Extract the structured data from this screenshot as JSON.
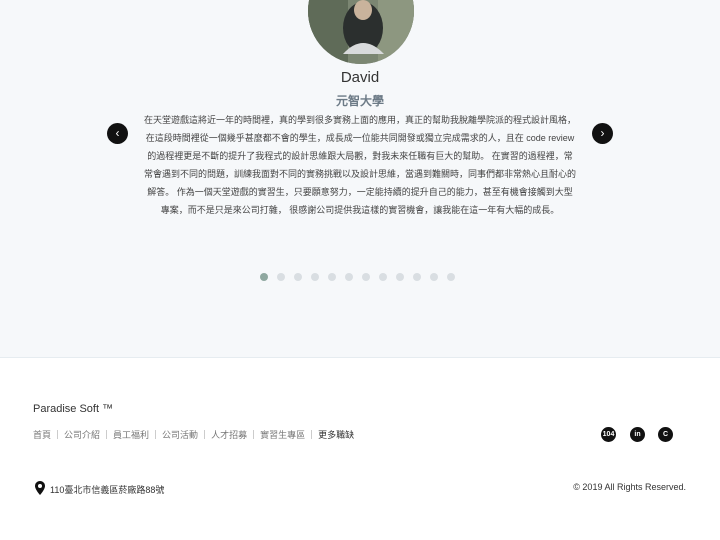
{
  "testimonial": {
    "name": "David",
    "school": "元智大學",
    "quote": "在天堂遊戲這將近一年的時間裡，真的學到很多實務上面的應用，真正的幫助我脫離學院派的程式設計風格，在這段時間裡從一個幾乎甚麼都不會的學生，成長成一位能共同開發或獨立完成需求的人，且在 code review 的過程裡更是不斷的提升了我程式的設計思維跟大局觀，對我未來任職有巨大的幫助。 在實習的過程裡，常常會遇到不同的問題，訓練我面對不同的實務挑戰以及設計思維，當遇到難關時，同事們都非常熱心且耐心的解答。 作為一個天堂遊戲的實習生，只要願意努力，一定能持續的提升自己的能力，甚至有機會接觸到大型專案，而不是只是來公司打雜， 很感謝公司提供我這樣的實習機會，讓我能在這一年有大幅的成長。",
    "prev_label": "‹",
    "next_label": "›",
    "slide_count": 12,
    "active_slide": 1
  },
  "footer": {
    "brand": "Paradise Soft ™",
    "nav": [
      "首頁",
      "公司介紹",
      "員工福利",
      "公司活動",
      "人才招募",
      "實習生專區",
      "更多職缺"
    ],
    "social": [
      {
        "icon": "104-icon",
        "label": "104"
      },
      {
        "icon": "linkedin-icon",
        "label": "in"
      },
      {
        "icon": "cakeresume-icon",
        "label": "C"
      }
    ],
    "address": "110臺北市信義區菸廠路88號",
    "copyright": "© 2019 All Rights Reserved."
  }
}
